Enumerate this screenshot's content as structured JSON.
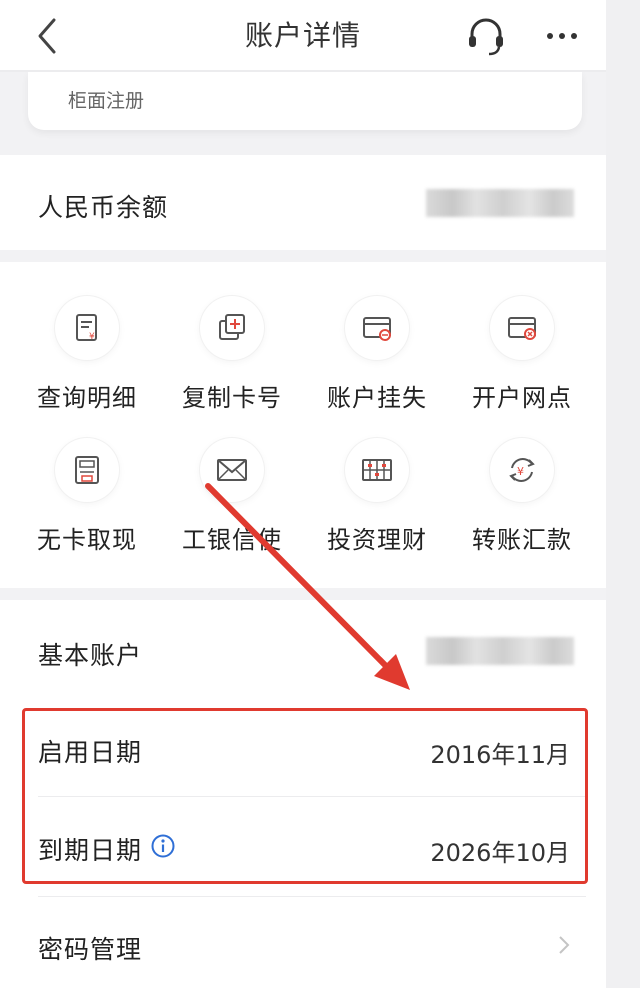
{
  "header": {
    "title": "账户详情",
    "back_icon": "chevron-left-icon",
    "support_icon": "headset-icon",
    "more_icon": "more-horizontal-icon"
  },
  "registration": {
    "label": "柜面注册"
  },
  "balance": {
    "label": "人民币余额",
    "value": ""
  },
  "actions": [
    {
      "label": "查询明细",
      "icon": "statement-icon"
    },
    {
      "label": "复制卡号",
      "icon": "copy-card-icon"
    },
    {
      "label": "账户挂失",
      "icon": "card-lost-icon"
    },
    {
      "label": "开户网点",
      "icon": "card-branch-icon"
    },
    {
      "label": "无卡取现",
      "icon": "atm-icon"
    },
    {
      "label": "工银信使",
      "icon": "envelope-icon"
    },
    {
      "label": "投资理财",
      "icon": "abacus-icon"
    },
    {
      "label": "转账汇款",
      "icon": "yuan-exchange-icon"
    }
  ],
  "account": {
    "type_label": "基本账户",
    "type_value": "",
    "start_label": "启用日期",
    "start_value": "2016年11月",
    "expiry_label": "到期日期",
    "expiry_value": "2026年10月",
    "password_label": "密码管理"
  },
  "colors": {
    "annotation_red": "#e03a2f",
    "icon_accent_red": "#e0483d",
    "info_blue": "#2f6fd6",
    "background": "#f2f2f4"
  }
}
